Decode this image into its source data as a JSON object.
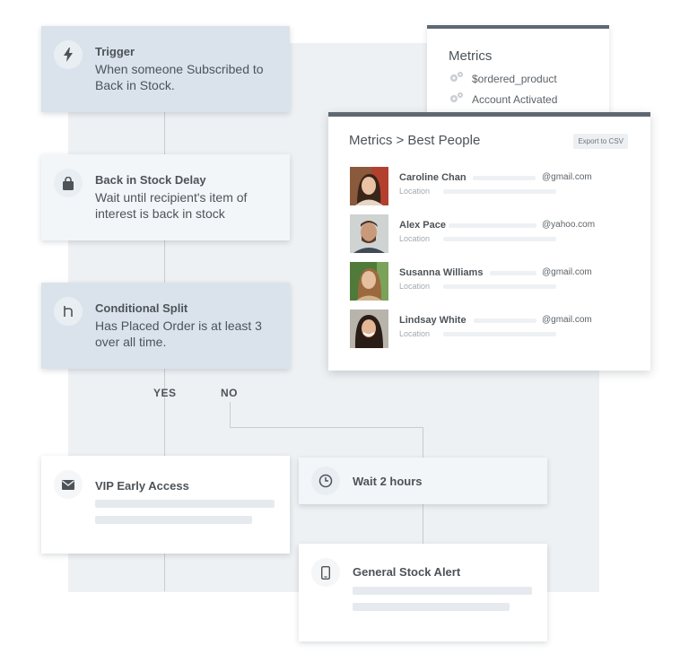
{
  "flow": {
    "trigger": {
      "title": "Trigger",
      "body_line1": "When someone Subscribed to",
      "body_line2": "Back in Stock.",
      "icon": "lightning-icon"
    },
    "delay": {
      "title": "Back in Stock Delay",
      "body_line1": "Wait until recipient's item of",
      "body_line2": "interest is back in stock",
      "icon": "shopping-bag-icon"
    },
    "split": {
      "title": "Conditional Split",
      "body_line1": "Has Placed Order is at least 3",
      "body_line2": "over all time.",
      "icon": "split-icon"
    },
    "yes_label": "YES",
    "no_label": "NO",
    "vip": {
      "title": "VIP Early Access",
      "icon": "mail-icon"
    },
    "wait": {
      "title": "Wait 2 hours",
      "icon": "clock-icon"
    },
    "alert": {
      "title": "General Stock Alert",
      "icon": "phone-icon"
    }
  },
  "metrics": {
    "title": "Metrics",
    "items": [
      {
        "label": "$ordered_product",
        "icon": "gears-icon"
      },
      {
        "label": "Account Activated",
        "icon": "gears-icon"
      }
    ]
  },
  "people": {
    "title": "Metrics > Best People",
    "export_label": "Export to CSV",
    "rows": [
      {
        "name": "Caroline Chan",
        "email": "@gmail.com",
        "location": "Location"
      },
      {
        "name": "Alex Pace",
        "email": "@yahoo.com",
        "location": "Location"
      },
      {
        "name": "Susanna Williams",
        "email": "@gmail.com",
        "location": "Location"
      },
      {
        "name": "Lindsay White",
        "email": "@gmail.com",
        "location": "Location"
      }
    ]
  },
  "colors": {
    "header_bar": "#5f6872",
    "card_blue": "#dae3ec",
    "card_light": "#f3f6f9",
    "background_panel": "#eef1f4"
  }
}
